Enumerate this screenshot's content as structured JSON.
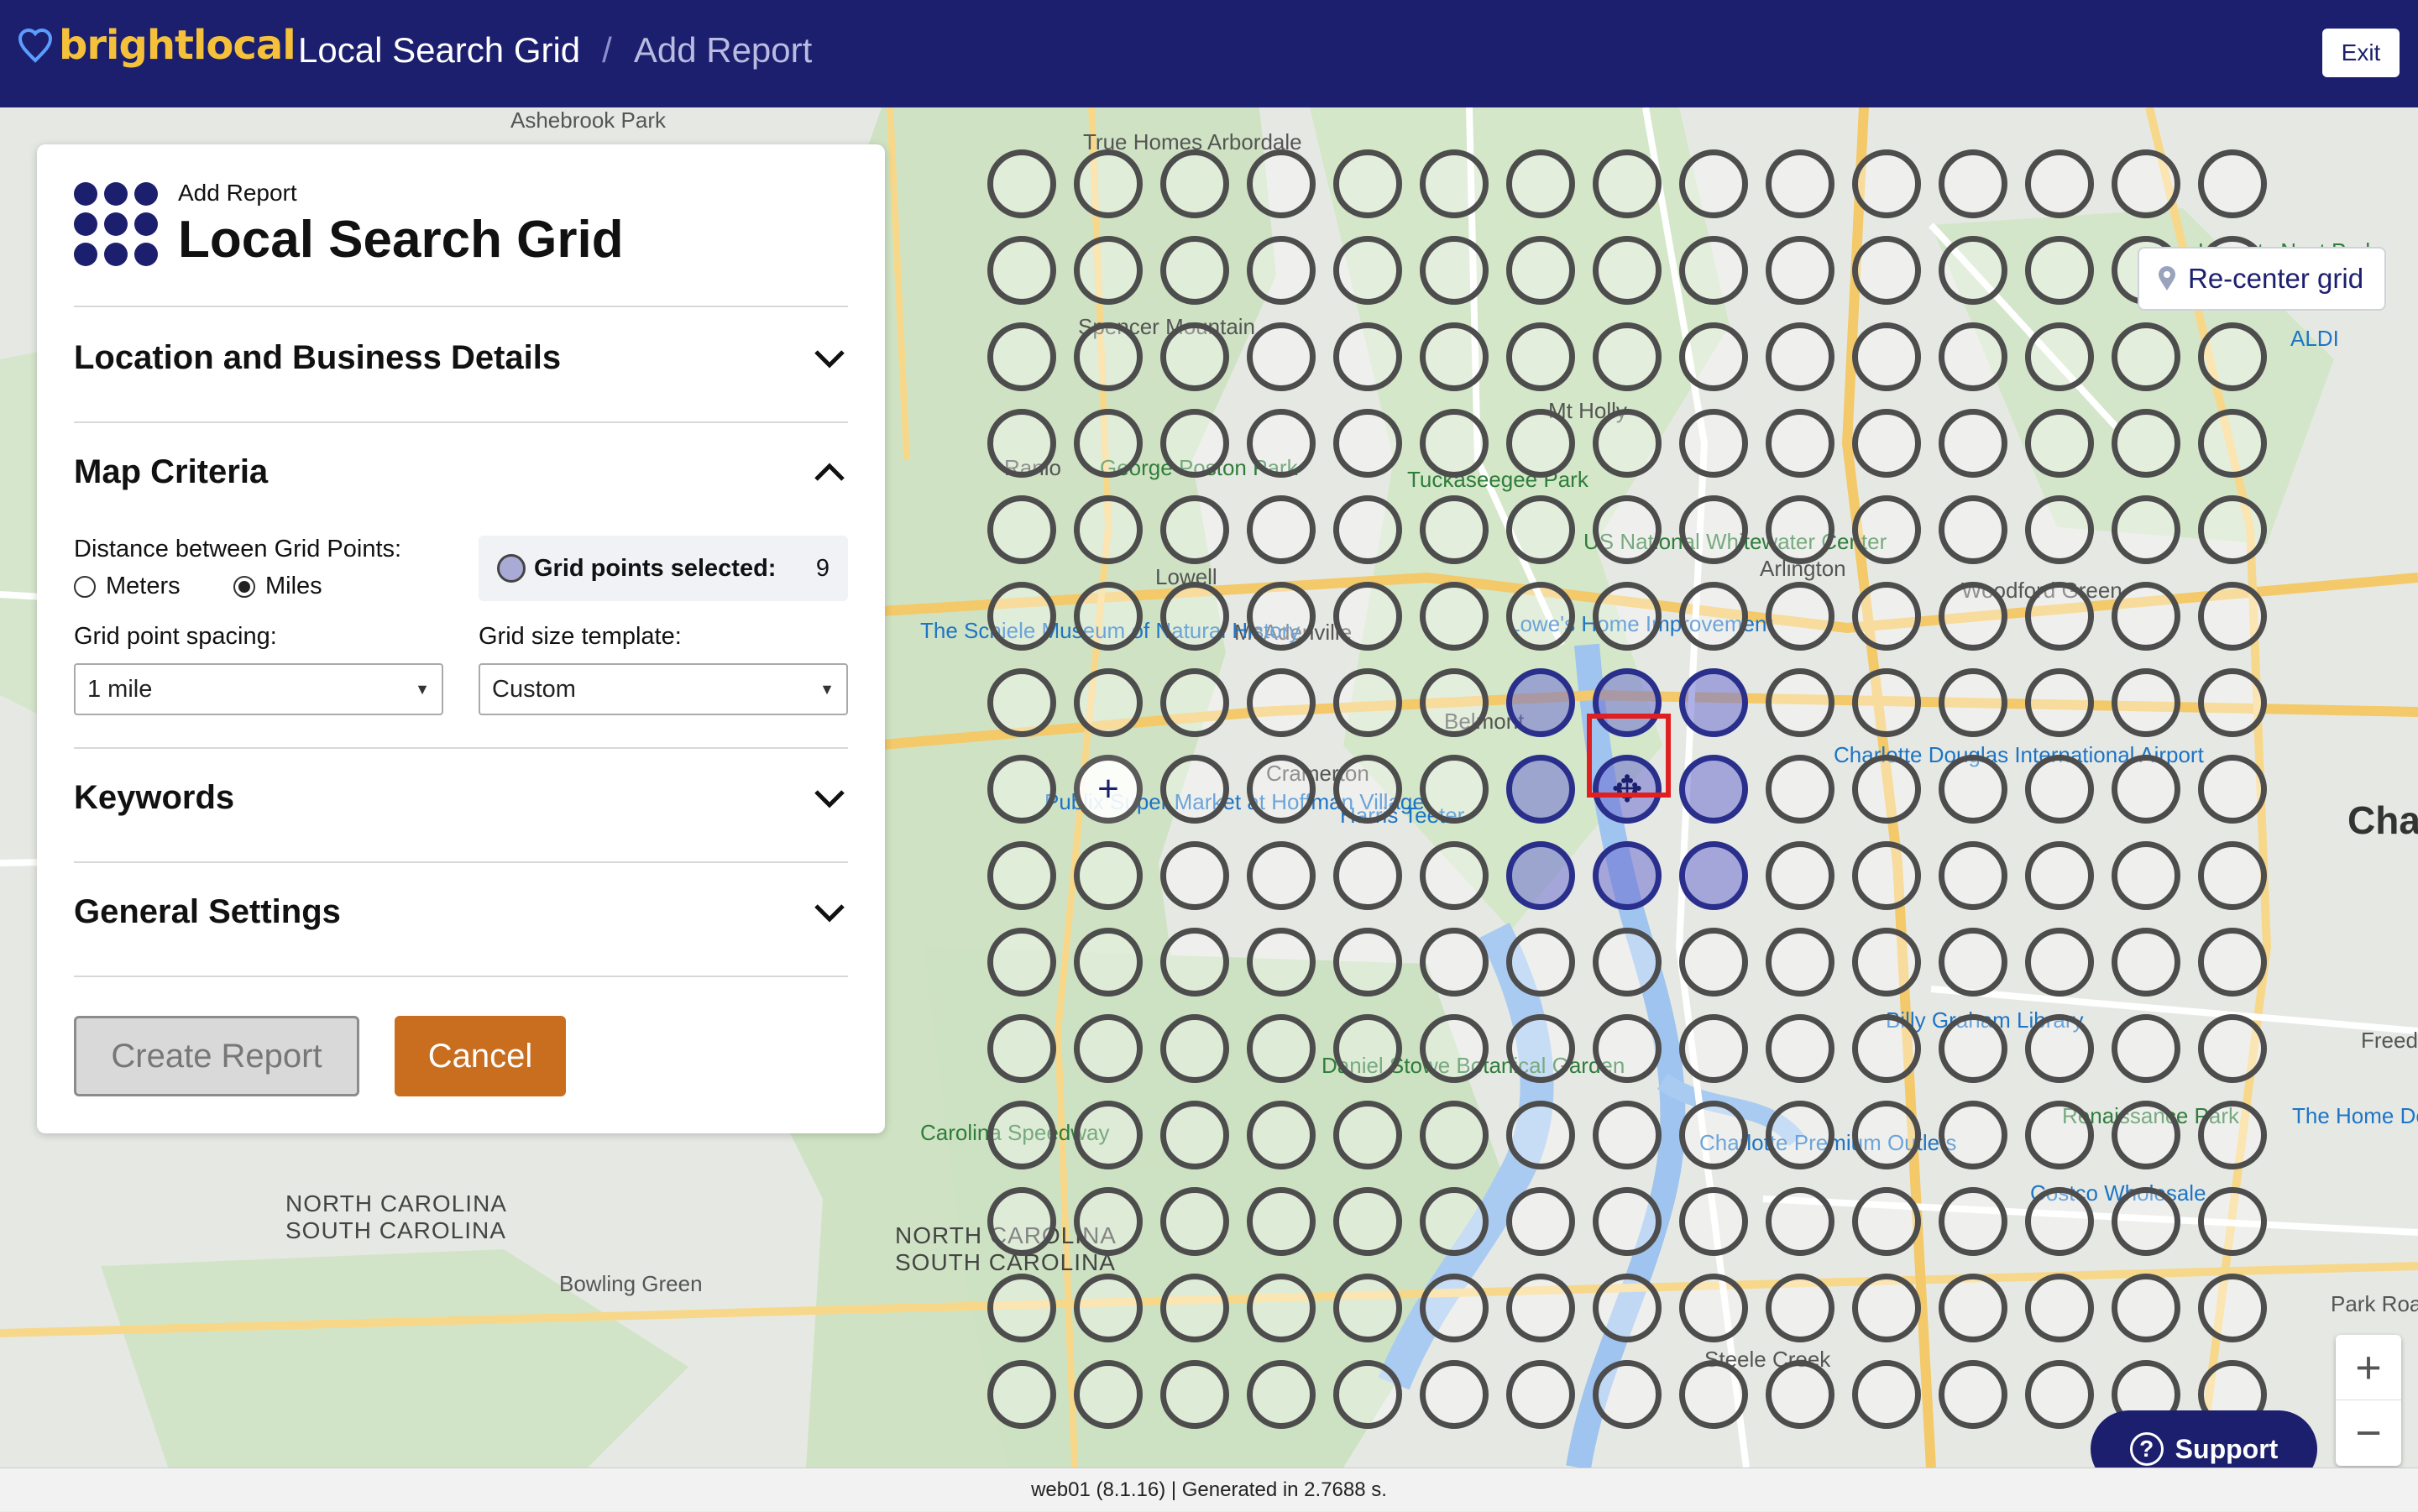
{
  "topbar": {
    "logo_text": "brightlocal",
    "breadcrumb": [
      "Local Search Grid",
      "/",
      "Add Report"
    ],
    "exit_label": "Exit"
  },
  "panel": {
    "subtitle": "Add Report",
    "title": "Local Search Grid",
    "sections": {
      "location": "Location and Business Details",
      "map_criteria": "Map Criteria",
      "keywords": "Keywords",
      "general": "General Settings"
    },
    "distance_label": "Distance between Grid Points:",
    "unit_options": [
      "Meters",
      "Miles"
    ],
    "unit_selected": "Miles",
    "selected_label": "Grid points selected:",
    "selected_count": "9",
    "spacing_label": "Grid point spacing:",
    "spacing_value": "1 mile",
    "template_label": "Grid size template:",
    "template_value": "Custom",
    "create_label": "Create Report",
    "cancel_label": "Cancel"
  },
  "map": {
    "recenter_label": "Re-center grid",
    "support_label": "Support",
    "zoom_in": "+",
    "zoom_out": "−",
    "labels": [
      "Ashebrook Park",
      "True Homes Arbordale",
      "Spencer Mountain",
      "Mt Holly",
      "Ranlo",
      "George Poston Park",
      "Lowell",
      "McAdenville",
      "Belmont",
      "Cramerton",
      "Tuckaseegee Park",
      "US National Whitewater Center",
      "Lowe's Home Improvement",
      "Arlington",
      "Woodford Green",
      "The Schiele Museum of Natural History",
      "Publix Super Market at Hoffman Village",
      "Harris Teeter",
      "Charlotte Douglas International Airport",
      "Carolina Speedway",
      "Daniel Stowe Botanical Garden",
      "Charlotte Premium Outlets",
      "Billy Graham Library",
      "Renaissance Park",
      "Costco Wholesale",
      "Bowling Green",
      "Steele Creek",
      "Hornets Nest Park",
      "ALDI",
      "Cha",
      "The Home Depot",
      "Park Road",
      "Freed",
      "NORTH CAROLINA",
      "SOUTH CAROLINA",
      "NORTH CAROLINA",
      "SOUTH CAROLINA"
    ]
  },
  "footer": {
    "text": "web01 (8.1.16) | Generated in 2.7688 s."
  },
  "colors": {
    "brand_navy": "#1c1f6e",
    "brand_yellow": "#f5c13a",
    "cancel_orange": "#c96d1f",
    "selected_point": "#6e70d2"
  }
}
